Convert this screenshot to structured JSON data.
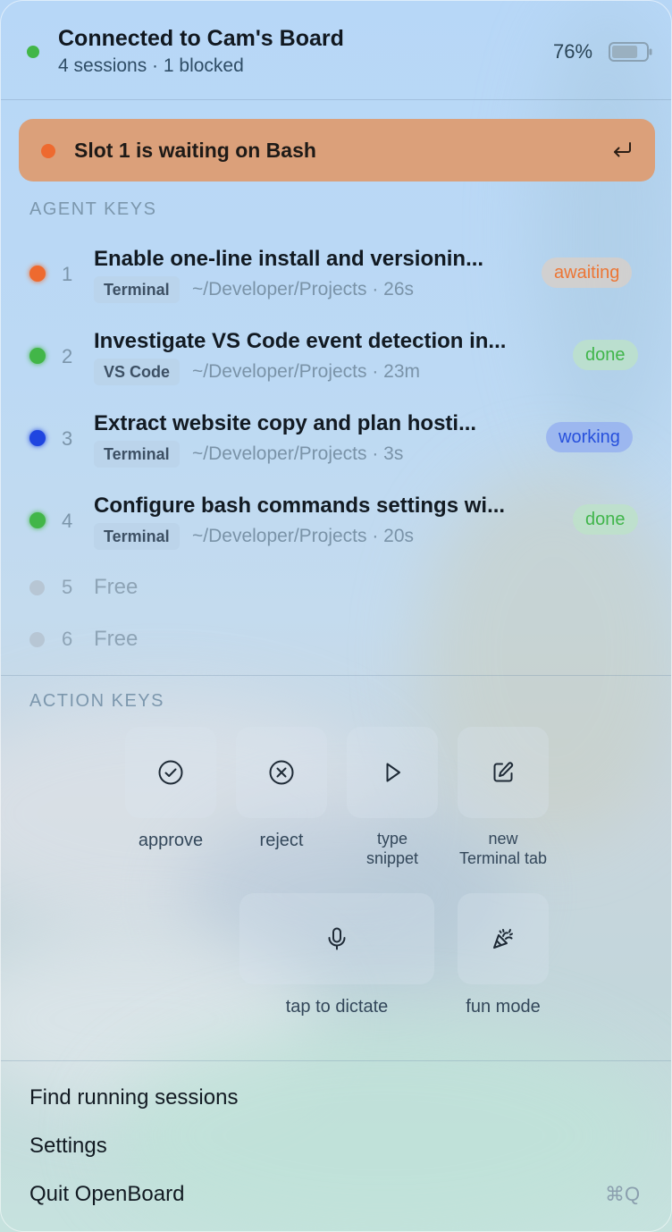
{
  "header": {
    "title": "Connected to Cam's Board",
    "subtitle": "4 sessions · 1 blocked",
    "battery_percent": "76%",
    "battery_level": 0.76,
    "status_color": "#42b648"
  },
  "alert": {
    "text": "Slot 1 is waiting on Bash",
    "dot_color": "#ee6a2f",
    "icon": "return-icon"
  },
  "agent_keys": {
    "label": "AGENT KEYS",
    "slots": [
      {
        "num": "1",
        "title": "Enable one-line install and versionin...",
        "app": "Terminal",
        "meta": "~/Developer/Projects · 26s",
        "status": "awaiting",
        "dot_color": "#ee6a2f"
      },
      {
        "num": "2",
        "title": "Investigate VS Code event detection in...",
        "app": "VS Code",
        "meta": "~/Developer/Projects · 23m",
        "status": "done",
        "dot_color": "#42b648"
      },
      {
        "num": "3",
        "title": "Extract website copy and plan hosti...",
        "app": "Terminal",
        "meta": "~/Developer/Projects · 3s",
        "status": "working",
        "dot_color": "#1f45e0"
      },
      {
        "num": "4",
        "title": "Configure bash commands settings wi...",
        "app": "Terminal",
        "meta": "~/Developer/Projects · 20s",
        "status": "done",
        "dot_color": "#42b648"
      }
    ],
    "free_slots": [
      {
        "num": "5",
        "label": "Free"
      },
      {
        "num": "6",
        "label": "Free"
      }
    ]
  },
  "action_keys": {
    "label": "ACTION KEYS",
    "keys": [
      {
        "label": "approve",
        "icon": "check-circle-icon"
      },
      {
        "label": "reject",
        "icon": "x-circle-icon"
      },
      {
        "label_lines": [
          "type",
          "snippet"
        ],
        "icon": "play-icon"
      },
      {
        "label_lines": [
          "new",
          "Terminal tab"
        ],
        "icon": "edit-icon"
      },
      {
        "label": "tap to dictate",
        "icon": "microphone-icon"
      },
      {
        "label": "fun mode",
        "icon": "party-popper-icon"
      }
    ]
  },
  "footer": {
    "find_sessions": "Find running sessions",
    "settings": "Settings",
    "quit": "Quit OpenBoard",
    "quit_shortcut": "⌘Q"
  },
  "colors": {
    "alert_bg": "#dba07a",
    "awaiting_text": "#ec7635",
    "done_text": "#40b54a",
    "working_text": "#2750dc"
  }
}
